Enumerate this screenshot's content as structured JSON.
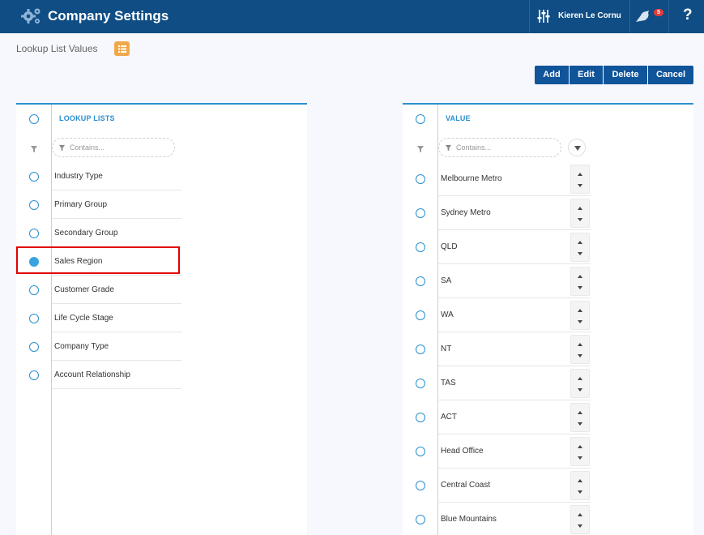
{
  "header": {
    "title": "Company Settings",
    "user": "Kieren Le Cornu",
    "notifications": "5",
    "help": "?"
  },
  "breadcrumb": "Lookup List Values",
  "toolbar": {
    "add": "Add",
    "edit": "Edit",
    "delete": "Delete",
    "cancel": "Cancel"
  },
  "left_panel": {
    "header": "LOOKUP LISTS",
    "filter_placeholder": "Contains...",
    "items": [
      {
        "label": "Industry Type",
        "selected": false
      },
      {
        "label": "Primary Group",
        "selected": false
      },
      {
        "label": "Secondary Group",
        "selected": false
      },
      {
        "label": "Sales Region",
        "selected": true
      },
      {
        "label": "Customer Grade",
        "selected": false
      },
      {
        "label": "Life Cycle Stage",
        "selected": false
      },
      {
        "label": "Company Type",
        "selected": false
      },
      {
        "label": "Account Relationship",
        "selected": false
      }
    ]
  },
  "right_panel": {
    "header": "VALUE",
    "filter_placeholder": "Contains...",
    "items": [
      {
        "label": "Melbourne Metro"
      },
      {
        "label": "Sydney Metro"
      },
      {
        "label": "QLD"
      },
      {
        "label": "SA"
      },
      {
        "label": "WA"
      },
      {
        "label": "NT"
      },
      {
        "label": "TAS"
      },
      {
        "label": "ACT"
      },
      {
        "label": "Head Office"
      },
      {
        "label": "Central Coast"
      },
      {
        "label": "Blue Mountains"
      }
    ]
  },
  "colors": {
    "header_bg": "#0f4d84",
    "accent": "#2a8fd0",
    "button": "#10549a",
    "highlight": "#e00000",
    "list_icon": "#f0a94a"
  }
}
